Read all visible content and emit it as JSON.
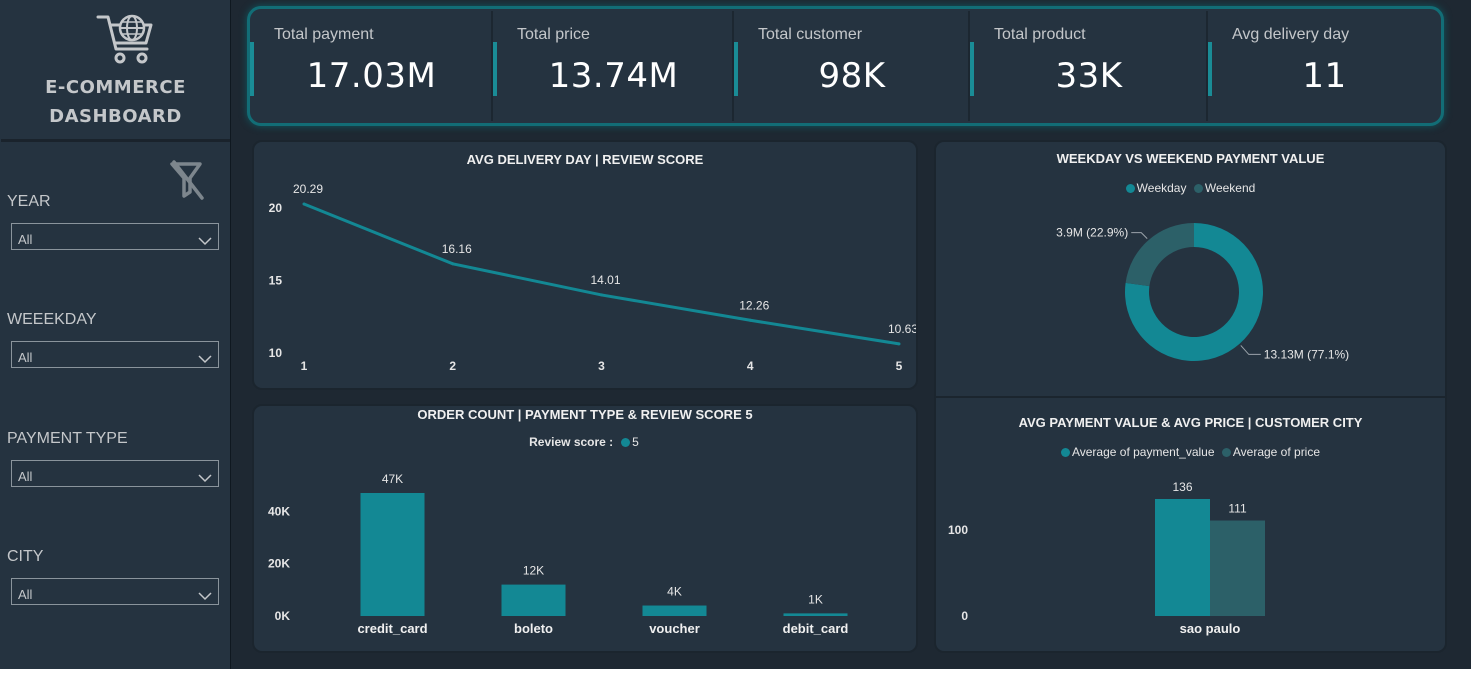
{
  "header": {
    "title_line1": "E-COMMERCE",
    "title_line2": "DASHBOARD"
  },
  "filters": [
    {
      "label": "YEAR",
      "value": "All"
    },
    {
      "label": "WEEEKDAY",
      "value": "All"
    },
    {
      "label": "PAYMENT TYPE",
      "value": "All"
    },
    {
      "label": "CITY",
      "value": "All"
    }
  ],
  "kpis": [
    {
      "label": "Total payment",
      "value": "17.03M"
    },
    {
      "label": "Total price",
      "value": "13.74M"
    },
    {
      "label": "Total customer",
      "value": "98K"
    },
    {
      "label": "Total product",
      "value": "33K"
    },
    {
      "label": "Avg delivery day",
      "value": "11"
    }
  ],
  "colors": {
    "background": "#1e2832",
    "panel": "#253340",
    "accent": "#138894",
    "secondary": "#2c6068",
    "text": "#e6e6e6"
  },
  "icons": [
    "shopping-cart-globe-icon",
    "clear-filter-icon",
    "chevron-down-icon"
  ],
  "chart_data": [
    {
      "type": "line",
      "title": "AVG DELIVERY DAY | REVIEW SCORE",
      "x": [
        1,
        2,
        3,
        4,
        5
      ],
      "series": [
        {
          "values": [
            20.29,
            16.16,
            14.01,
            12.26,
            10.63
          ],
          "color": "#138894"
        }
      ],
      "data_labels": [
        "20.29",
        "16.16",
        "14.01",
        "12.26",
        "10.63"
      ],
      "y_ticks": [
        10,
        15,
        20
      ],
      "ylim": [
        10,
        20.29
      ],
      "grid": false
    },
    {
      "type": "bar",
      "title": "ORDER COUNT | PAYMENT TYPE & REVIEW SCORE 5",
      "legend_title": "Review score :",
      "categories": [
        "credit_card",
        "boleto",
        "voucher",
        "debit_card"
      ],
      "series": [
        {
          "name": "5",
          "values": [
            47000,
            12000,
            4000,
            1000
          ],
          "color": "#138894"
        }
      ],
      "data_labels": [
        "47K",
        "12K",
        "4K",
        "1K"
      ],
      "y_ticks": [
        {
          "value": 0,
          "label": "0K"
        },
        {
          "value": 20000,
          "label": "20K"
        },
        {
          "value": 40000,
          "label": "40K"
        }
      ],
      "ylim": [
        0,
        47000
      ],
      "legend": "top-center",
      "grid": false
    },
    {
      "type": "pie",
      "title": "WEEKDAY VS WEEKEND PAYMENT VALUE",
      "donut": true,
      "slices": [
        {
          "name": "Weekday",
          "value": 13.13,
          "percent": 77.1,
          "label": "13.13M (77.1%)",
          "color": "#138894"
        },
        {
          "name": "Weekend",
          "value": 3.9,
          "percent": 22.9,
          "label": "3.9M (22.9%)",
          "color": "#2c6068"
        }
      ],
      "legend": "top-center"
    },
    {
      "type": "bar",
      "title": "AVG PAYMENT VALUE & AVG PRICE | CUSTOMER CITY",
      "categories": [
        "sao paulo"
      ],
      "series": [
        {
          "name": "Average of payment_value",
          "values": [
            136
          ],
          "color": "#138894"
        },
        {
          "name": "Average of price",
          "values": [
            111
          ],
          "color": "#2c6068"
        }
      ],
      "data_labels": [
        [
          "136"
        ],
        [
          "111"
        ]
      ],
      "y_ticks": [
        {
          "value": 0,
          "label": "0"
        },
        {
          "value": 100,
          "label": "100"
        }
      ],
      "ylim": [
        0,
        136
      ],
      "legend": "top-center",
      "grid": false
    }
  ]
}
